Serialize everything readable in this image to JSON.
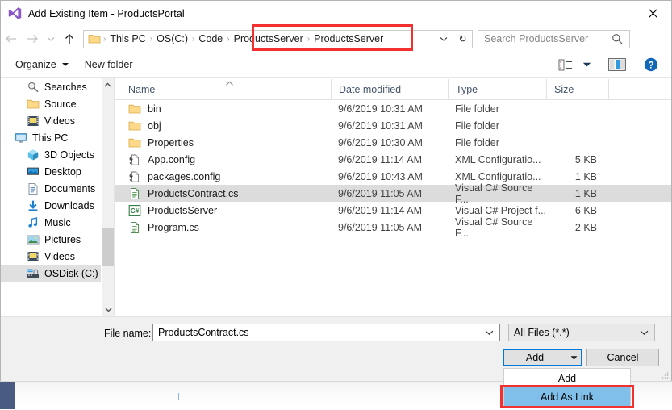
{
  "window": {
    "title": "Add Existing Item - ProductsPortal",
    "app_icon": "visual-studio-icon",
    "close_label": "✕"
  },
  "navbar": {
    "back_icon": "back-arrow-icon",
    "forward_icon": "forward-arrow-icon",
    "recent_icon": "chevron-down-icon",
    "up_icon": "up-arrow-icon",
    "breadcrumbs": [
      "This PC",
      "OS(C:)",
      "Code",
      "ProductsServer",
      "ProductsServer"
    ],
    "separator": "❯",
    "dropdown_icon": "chevron-down-icon",
    "refresh_icon": "refresh-icon",
    "refresh_glyph": "↻",
    "search_placeholder": "Search ProductsServer",
    "search_icon": "search-icon",
    "highlight_color": "#f23030"
  },
  "commandbar": {
    "organize_label": "Organize",
    "new_folder_label": "New folder",
    "view_icon": "list-view-icon",
    "view_caret_icon": "chevron-down-icon",
    "preview_icon": "preview-pane-icon",
    "help_icon": "help-icon",
    "help_glyph": "?"
  },
  "navpane": {
    "items": [
      {
        "label": "Searches",
        "icon": "search-folder-icon",
        "indent": 1,
        "selected": false
      },
      {
        "label": "Source",
        "icon": "folder-icon",
        "indent": 1,
        "selected": false
      },
      {
        "label": "Videos",
        "icon": "videos-icon",
        "indent": 1,
        "selected": false
      },
      {
        "label": "This PC",
        "icon": "this-pc-icon",
        "indent": 0,
        "selected": false
      },
      {
        "label": "3D Objects",
        "icon": "3d-objects-icon",
        "indent": 1,
        "selected": false
      },
      {
        "label": "Desktop",
        "icon": "desktop-icon",
        "indent": 1,
        "selected": false
      },
      {
        "label": "Documents",
        "icon": "documents-icon",
        "indent": 1,
        "selected": false
      },
      {
        "label": "Downloads",
        "icon": "downloads-icon",
        "indent": 1,
        "selected": false
      },
      {
        "label": "Music",
        "icon": "music-icon",
        "indent": 1,
        "selected": false
      },
      {
        "label": "Pictures",
        "icon": "pictures-icon",
        "indent": 1,
        "selected": false
      },
      {
        "label": "Videos",
        "icon": "videos-icon",
        "indent": 1,
        "selected": false
      },
      {
        "label": "OSDisk (C:)",
        "icon": "disk-drive-icon",
        "indent": 1,
        "selected": true
      }
    ],
    "scroll_up_glyph": "⌃",
    "scroll_down_glyph": "⌄"
  },
  "filelist": {
    "columns": [
      "Name",
      "Date modified",
      "Type",
      "Size"
    ],
    "sort_indicator": "⌃",
    "rows": [
      {
        "name": "bin",
        "icon": "folder-icon",
        "date": "9/6/2019 10:31 AM",
        "type": "File folder",
        "size": "",
        "selected": false
      },
      {
        "name": "obj",
        "icon": "folder-icon",
        "date": "9/6/2019 10:31 AM",
        "type": "File folder",
        "size": "",
        "selected": false
      },
      {
        "name": "Properties",
        "icon": "folder-icon",
        "date": "9/6/2019 10:30 AM",
        "type": "File folder",
        "size": "",
        "selected": false
      },
      {
        "name": "App.config",
        "icon": "config-file-icon",
        "date": "9/6/2019 11:14 AM",
        "type": "XML Configuratio...",
        "size": "5 KB",
        "selected": false
      },
      {
        "name": "packages.config",
        "icon": "config-file-icon",
        "date": "9/6/2019 10:43 AM",
        "type": "XML Configuratio...",
        "size": "1 KB",
        "selected": false
      },
      {
        "name": "ProductsContract.cs",
        "icon": "csharp-source-icon",
        "date": "9/6/2019 11:05 AM",
        "type": "Visual C# Source F...",
        "size": "1 KB",
        "selected": true
      },
      {
        "name": "ProductsServer",
        "icon": "csharp-project-icon",
        "date": "9/6/2019 11:14 AM",
        "type": "Visual C# Project f...",
        "size": "6 KB",
        "selected": false
      },
      {
        "name": "Program.cs",
        "icon": "csharp-source-icon",
        "date": "9/6/2019 11:05 AM",
        "type": "Visual C# Source F...",
        "size": "2 KB",
        "selected": false
      }
    ]
  },
  "bottom": {
    "filename_label": "File name:",
    "filename_value": "ProductsContract.cs",
    "filename_caret_icon": "chevron-down-icon",
    "filter_value": "All Files (*.*)",
    "filter_caret_icon": "chevron-down-icon",
    "add_label": "Add",
    "add_arrow_icon": "caret-down-icon",
    "cancel_label": "Cancel",
    "resize_grip_icon": "resize-grip-icon"
  },
  "add_menu": {
    "items": [
      {
        "label": "Add",
        "highlighted": false
      },
      {
        "label": "Add As Link",
        "highlighted": true
      }
    ],
    "highlight_bg": "#7fbfea",
    "annotation_color": "#f23030"
  }
}
